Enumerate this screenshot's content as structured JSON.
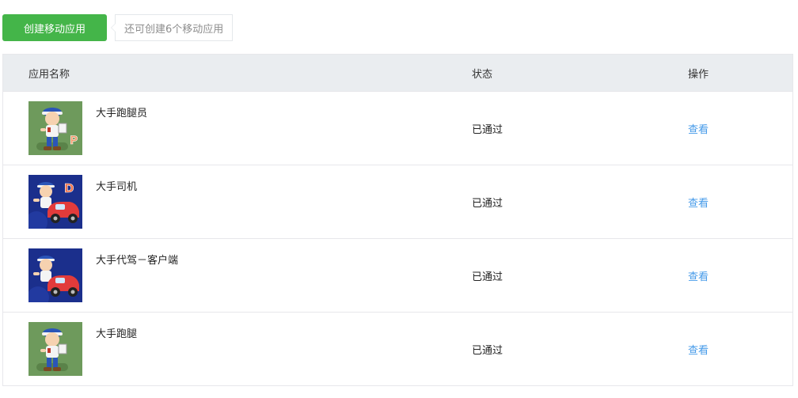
{
  "toolbar": {
    "create_label": "创建移动应用",
    "quota_tip": "还可创建6个移动应用"
  },
  "table": {
    "headers": {
      "name": "应用名称",
      "status": "状态",
      "action": "操作"
    },
    "rows": [
      {
        "name": "大手跑腿员",
        "status": "已通过",
        "action": "查看",
        "icon": "courier-cartoon-icon",
        "icon_letter": "P",
        "icon_bg": "#6e9a5c"
      },
      {
        "name": "大手司机",
        "status": "已通过",
        "action": "查看",
        "icon": "driver-car-cartoon-icon",
        "icon_letter": "D",
        "icon_bg": "#1b2f8c"
      },
      {
        "name": "大手代驾－客户端",
        "status": "已通过",
        "action": "查看",
        "icon": "driver-car-cartoon-icon",
        "icon_bg": "#1b2f8c"
      },
      {
        "name": "大手跑腿",
        "status": "已通过",
        "action": "查看",
        "icon": "courier-cartoon-icon",
        "icon_bg": "#6e9a5c"
      }
    ]
  },
  "colors": {
    "primary_button": "#44b549",
    "link": "#459ae9",
    "header_bg": "#eaedf0",
    "border": "#e7e7eb"
  }
}
